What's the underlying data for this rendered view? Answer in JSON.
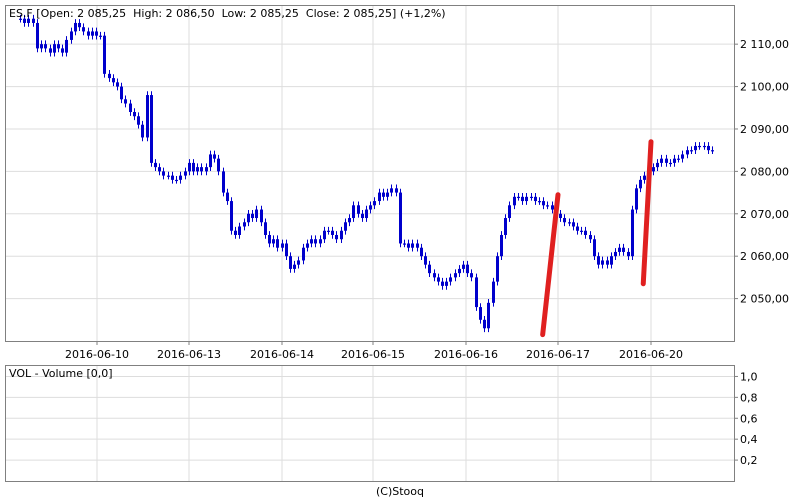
{
  "chart_data": [
    {
      "type": "candlestick",
      "instrument": "ES.F",
      "header": {
        "open_label": "Open:",
        "open": "2 085,25",
        "high_label": "High:",
        "high": "2 086,50",
        "low_label": "Low:",
        "low": "2 085,25",
        "close_label": "Close:",
        "close": "2 085,25",
        "change": "(+1,2%)"
      },
      "y_ticks": [
        "2 050,00",
        "2 060,00",
        "2 070,00",
        "2 080,00",
        "2 090,00",
        "2 100,00",
        "2 110,00"
      ],
      "y_tick_values": [
        2050,
        2060,
        2070,
        2080,
        2090,
        2100,
        2110
      ],
      "ylim": [
        2040,
        2119
      ],
      "x_ticks": [
        "2016-06-10",
        "2016-06-13",
        "2016-06-14",
        "2016-06-15",
        "2016-06-16",
        "2016-06-17",
        "2016-06-20"
      ],
      "grid": true,
      "colors": {
        "candle": "#0000cc",
        "trendline": "#e02020",
        "grid": "#dddddd"
      },
      "trendlines": [
        {
          "from": [
            "2016-06-16 ~20:00",
            2041.5
          ],
          "to": [
            "2016-06-17 ~00:00",
            2074.5
          ]
        },
        {
          "from": [
            "2016-06-17 ~22:00",
            2053.5
          ],
          "to": [
            "2016-06-20 ~00:00",
            2087.0
          ]
        }
      ],
      "price_path": [
        2116,
        2115,
        2116,
        2115,
        2109,
        2110,
        2109,
        2108,
        2110,
        2109,
        2108,
        2111,
        2113,
        2115,
        2114,
        2113,
        2112,
        2113,
        2112,
        2112,
        2103,
        2102,
        2101,
        2100,
        2097,
        2096,
        2094,
        2093,
        2091,
        2088,
        2098,
        2082,
        2081,
        2080,
        2079,
        2079,
        2078,
        2078,
        2079,
        2080,
        2082,
        2080,
        2081,
        2080,
        2081,
        2084,
        2083,
        2080,
        2075,
        2073,
        2066,
        2065,
        2067,
        2068,
        2070,
        2069,
        2071,
        2068,
        2065,
        2063,
        2064,
        2062,
        2063,
        2060,
        2057,
        2058,
        2059,
        2062,
        2063,
        2064,
        2063,
        2064,
        2066,
        2066,
        2065,
        2064,
        2066,
        2068,
        2069,
        2072,
        2070,
        2069,
        2071,
        2072,
        2073,
        2075,
        2074,
        2075,
        2076,
        2075,
        2063,
        2063,
        2062,
        2063,
        2062,
        2060,
        2058,
        2056,
        2055,
        2054,
        2053,
        2054,
        2055,
        2056,
        2057,
        2058,
        2056,
        2055,
        2048,
        2045,
        2043,
        2049,
        2054,
        2060,
        2065,
        2069,
        2072,
        2074,
        2074,
        2073,
        2074,
        2074,
        2073,
        2073,
        2072,
        2072,
        2071,
        2070,
        2069,
        2068,
        2068,
        2067,
        2066,
        2066,
        2065,
        2064,
        2060,
        2058,
        2059,
        2058,
        2060,
        2061,
        2062,
        2061,
        2060,
        2071,
        2076,
        2078,
        2079,
        2080,
        2081,
        2082,
        2083,
        2082,
        2082,
        2083,
        2083,
        2084,
        2085,
        2085,
        2086,
        2086,
        2086,
        2085,
        2085
      ]
    },
    {
      "type": "bar",
      "title": "VOL - Volume [0,0]",
      "y_ticks": [
        "0,2",
        "0,4",
        "0,6",
        "0,8",
        "1,0"
      ],
      "y_tick_values": [
        0.2,
        0.4,
        0.6,
        0.8,
        1.0
      ],
      "ylim": [
        0,
        1.1
      ],
      "values": []
    }
  ],
  "footer": "(C)Stooq"
}
